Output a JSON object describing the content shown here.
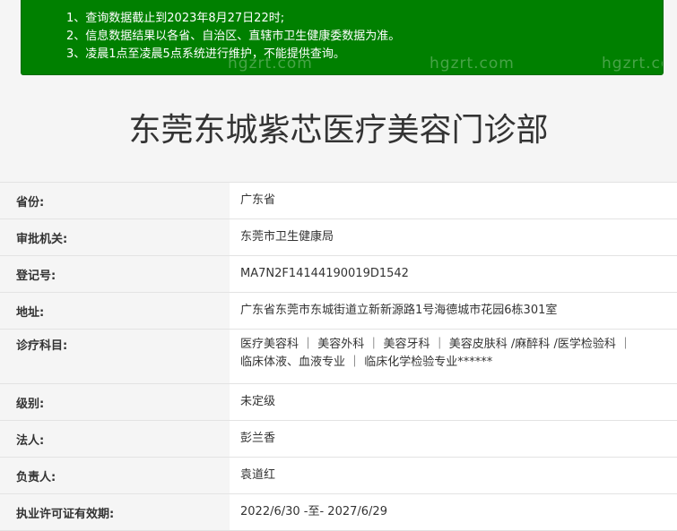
{
  "notice": {
    "lines": [
      "1、查询数据截止到2023年8月27日22时;",
      "2、信息数据结果以各省、自治区、直辖市卫生健康委数据为准。",
      "3、凌晨1点至凌晨5点系统进行维护，不能提供查询。"
    ],
    "watermark": "hgzrt.com"
  },
  "title": "东莞东城紫芯医疗美容门诊部",
  "fields": [
    {
      "label": "省份:",
      "value": "广东省"
    },
    {
      "label": "审批机关:",
      "value": "东莞市卫生健康局"
    },
    {
      "label": "登记号:",
      "value": "MA7N2F14144190019D1542"
    },
    {
      "label": "地址:",
      "value": "广东省东莞市东城街道立新新源路1号海德城市花园6栋301室"
    },
    {
      "label": "诊疗科目:",
      "value": "医疗美容科 ｜ 美容外科 ｜ 美容牙科 ｜ 美容皮肤科 /麻醉科 /医学检验科 ｜ 临床体液、血液专业 ｜ 临床化学检验专业******"
    },
    {
      "label": "级别:",
      "value": "未定级"
    },
    {
      "label": "法人:",
      "value": "彭兰香"
    },
    {
      "label": "负责人:",
      "value": "袁道红"
    },
    {
      "label": "执业许可证有效期:",
      "value": "2022/6/30 -至- 2027/6/29"
    }
  ],
  "colors": {
    "notice_bg": "#008000",
    "page_bg": "#f5f5f5",
    "value_bg": "#ffffff"
  }
}
